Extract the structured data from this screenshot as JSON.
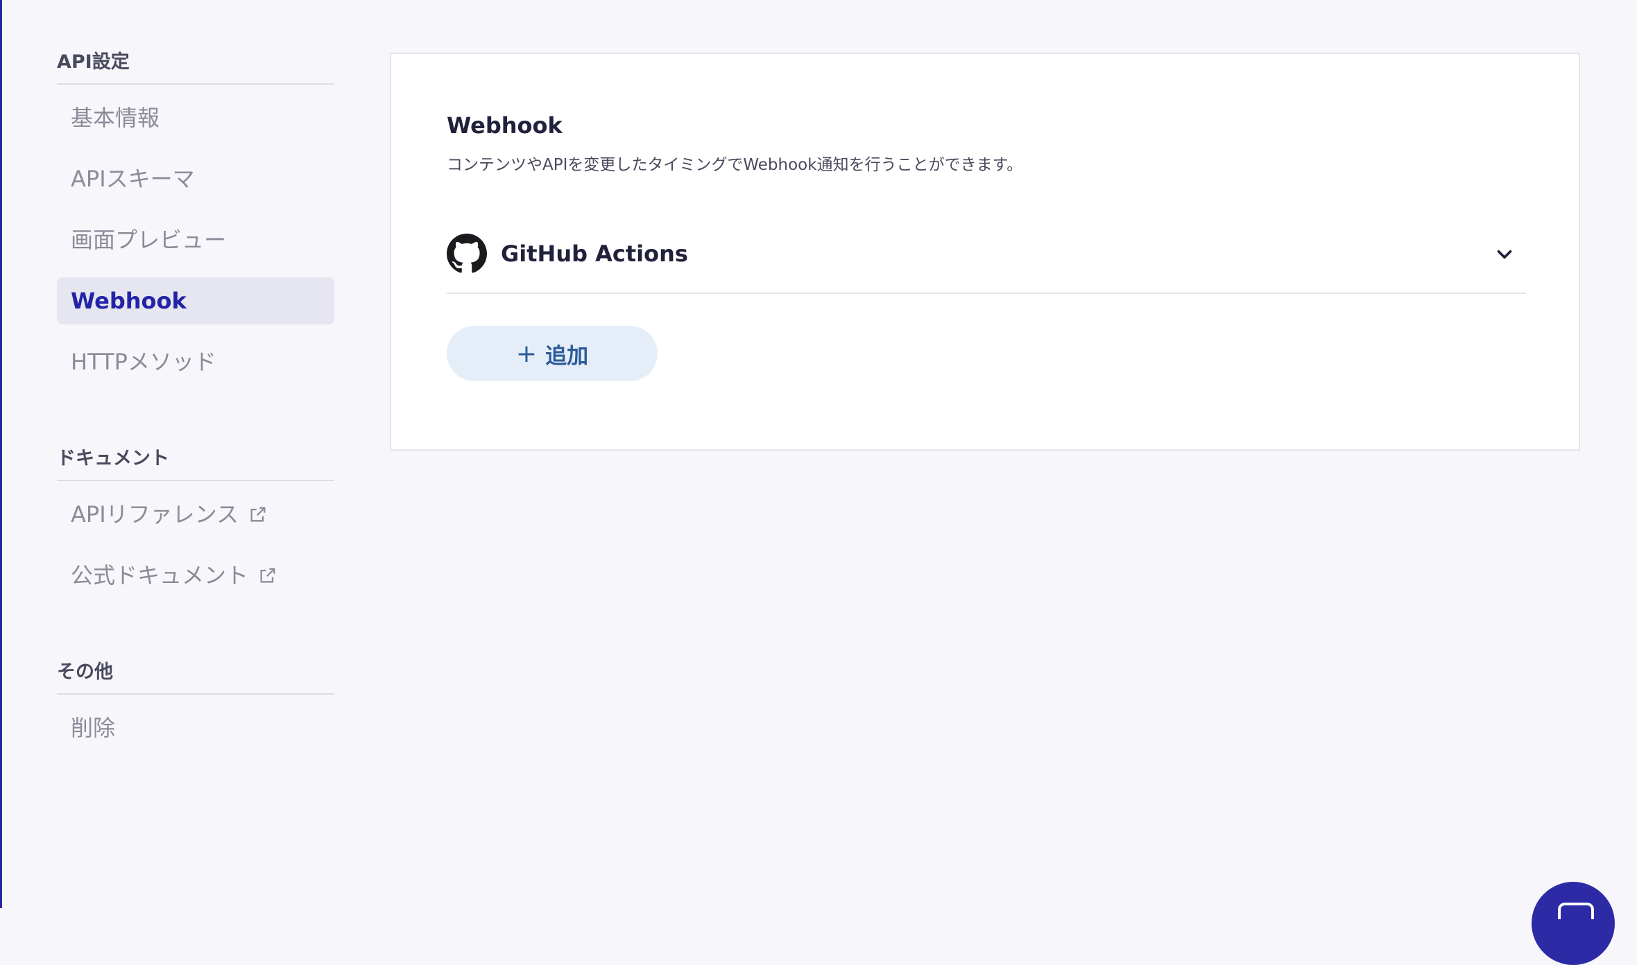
{
  "sidebar": {
    "sections": [
      {
        "title": "API設定",
        "items": [
          {
            "label": "基本情報"
          },
          {
            "label": "APIスキーマ"
          },
          {
            "label": "画面プレビュー"
          },
          {
            "label": "Webhook"
          },
          {
            "label": "HTTPメソッド"
          }
        ]
      },
      {
        "title": "ドキュメント",
        "items": [
          {
            "label": "APIリファレンス"
          },
          {
            "label": "公式ドキュメント"
          }
        ]
      },
      {
        "title": "その他",
        "items": [
          {
            "label": "削除"
          }
        ]
      }
    ]
  },
  "main": {
    "title": "Webhook",
    "description": "コンテンツやAPIを変更したタイミングでWebhook通知を行うことができます。",
    "webhooks": [
      {
        "name": "GitHub Actions",
        "icon": "github-icon"
      }
    ],
    "add_button": {
      "plus": "+",
      "label": "追加"
    }
  },
  "colors": {
    "accent": "#2323a8",
    "active_bg": "#e6e6f0",
    "add_button_bg": "#e5eef8",
    "add_button_text": "#2b5a9a",
    "chat_bubble": "#2d2aa6"
  }
}
